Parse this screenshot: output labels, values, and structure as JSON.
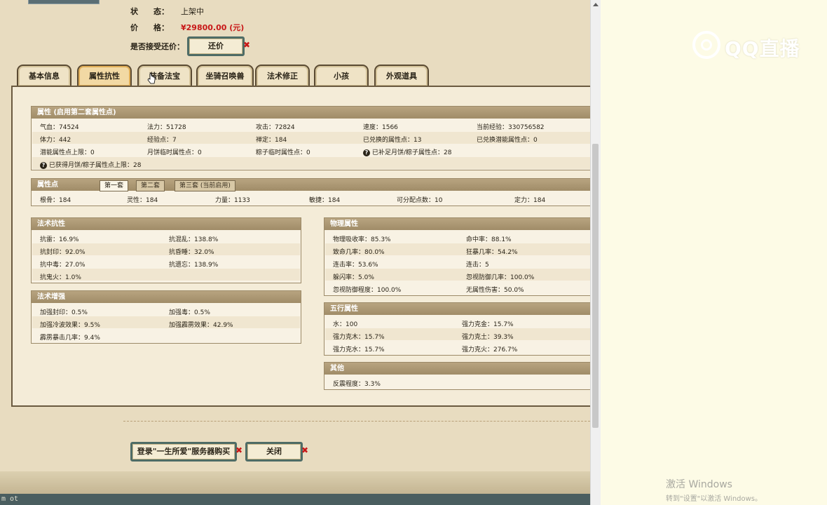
{
  "info": {
    "status_label": "状　　态：",
    "status_value": "上架中",
    "price_label": "价　　格：",
    "price_value": "¥29800.00 (元)",
    "bargain_label": "是否接受还价：",
    "bargain_button": "还价",
    "x_mark": "✖"
  },
  "tabs": [
    "基本信息",
    "属性抗性",
    "装备法宝",
    "坐骑召唤兽",
    "法术修正",
    "小孩",
    "外观道具"
  ],
  "attributes": {
    "title": "属性 (启用第二套属性点)",
    "rows": [
      [
        "气血：74524",
        "法力：51728",
        "攻击：72824",
        "速度：1566",
        "当前经验：330756582"
      ],
      [
        "体力：442",
        "经验点：7",
        "禅定：184",
        "已兑换的属性点：13",
        "已兑换潜能属性点：0"
      ],
      [
        "潜能属性点上限：0",
        "月饼临时属性点：0",
        "粽子临时属性点：0",
        "已补足月饼/粽子属性点：28",
        ""
      ],
      [
        "已获得月饼/粽子属性点上限：28"
      ]
    ]
  },
  "points": {
    "title": "属性点",
    "subtabs": [
      "第一套",
      "第二套",
      "第三套 (当前启用)"
    ],
    "row": [
      "根骨：184",
      "灵性：184",
      "力量：1133",
      "敏捷：184",
      "可分配点数：10",
      "定力：184"
    ]
  },
  "spell_resist": {
    "title": "法术抗性",
    "rows": [
      [
        "抗雷：16.9%",
        "抗混乱：138.8%"
      ],
      [
        "抗封印：92.0%",
        "抗昏睡：32.0%"
      ],
      [
        "抗中毒：27.0%",
        "抗遗忘：138.9%"
      ],
      [
        "抗鬼火：1.0%",
        ""
      ]
    ]
  },
  "spell_boost": {
    "title": "法术增强",
    "rows": [
      [
        "加强封印：0.5%",
        "加强毒：0.5%"
      ],
      [
        "加强冷波效果：9.5%",
        "加强霹雳效果：42.9%"
      ],
      [
        "霹雳暴击几率：9.4%",
        ""
      ]
    ]
  },
  "physical": {
    "title": "物理属性",
    "rows": [
      [
        "物理吸收率：85.3%",
        "命中率：88.1%"
      ],
      [
        "致命几率：80.0%",
        "狂暴几率：54.2%"
      ],
      [
        "连击率：53.6%",
        "连击：5"
      ],
      [
        "躲闪率：5.0%",
        "忽视防御几率：100.0%"
      ],
      [
        "忽视防御程度：100.0%",
        "无属性伤害：50.0%"
      ]
    ]
  },
  "five_elements": {
    "title": "五行属性",
    "rows": [
      [
        "水：100",
        "强力克金：15.7%"
      ],
      [
        "强力克木：15.7%",
        "强力克土：39.3%"
      ],
      [
        "强力克水：15.7%",
        "强力克火：276.7%"
      ]
    ]
  },
  "other": {
    "title": "其他",
    "rows": [
      [
        "反震程度：3.3%"
      ]
    ]
  },
  "footer": {
    "login_button": "登录\"一生所爱\"服务器购买",
    "close_button": "关闭"
  },
  "watermark": {
    "logo_text": "QQ直播",
    "activate_title": "激活 Windows",
    "activate_sub": "转到\"设置\"以激活 Windows。"
  },
  "taskbar_text": "m ot"
}
